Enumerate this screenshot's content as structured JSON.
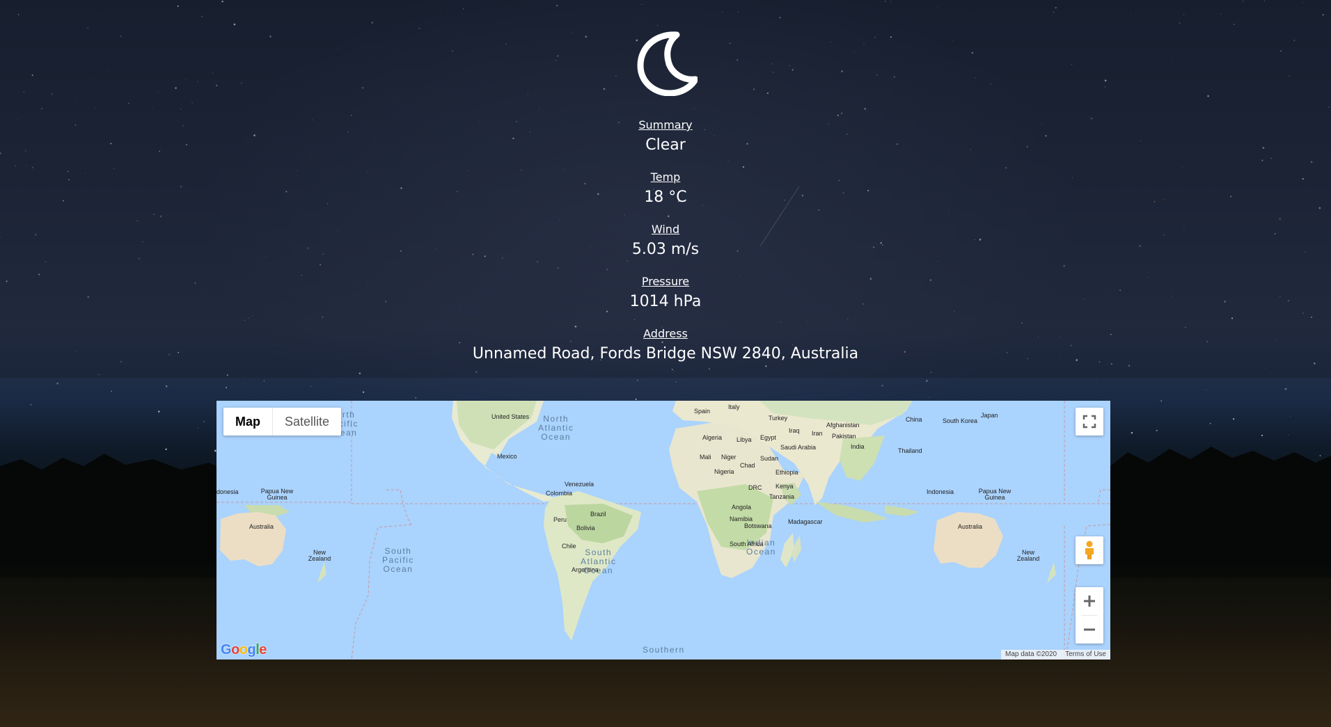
{
  "weather": {
    "icon": "crescent-moon-icon",
    "summary": {
      "label": "Summary",
      "value": "Clear"
    },
    "temp": {
      "label": "Temp",
      "value": "18 °C"
    },
    "wind": {
      "label": "Wind",
      "value": "5.03 m/s"
    },
    "pressure": {
      "label": "Pressure",
      "value": "1014 hPa"
    },
    "address": {
      "label": "Address",
      "value": "Unnamed Road, Fords Bridge NSW 2840, Australia"
    }
  },
  "map": {
    "type_control": {
      "map": "Map",
      "satellite": "Satellite",
      "selected": "Map"
    },
    "attribution": {
      "data": "Map data ©2020",
      "terms": "Terms of Use"
    },
    "logo": "Google",
    "countries": [
      "United States",
      "Mexico",
      "Colombia",
      "Venezuela",
      "Brazil",
      "Peru",
      "Bolivia",
      "Chile",
      "Argentina",
      "Spain",
      "Italy",
      "Turkey",
      "Algeria",
      "Libya",
      "Egypt",
      "Mali",
      "Niger",
      "Chad",
      "Sudan",
      "Nigeria",
      "Ethiopia",
      "DRC",
      "Kenya",
      "Tanzania",
      "Angola",
      "Namibia",
      "Botswana",
      "South Africa",
      "Madagascar",
      "Saudi Arabia",
      "Iraq",
      "Iran",
      "Afghanistan",
      "Pakistan",
      "India",
      "China",
      "South Korea",
      "Japan",
      "Thailand",
      "Indonesia",
      "Papua New Guinea",
      "Australia",
      "New Zealand",
      "donesia"
    ],
    "oceans": [
      "North Pacific Ocean",
      "North Atlantic Ocean",
      "South Pacific Ocean",
      "South Atlantic Ocean",
      "Indian Ocean",
      "Southern"
    ]
  }
}
